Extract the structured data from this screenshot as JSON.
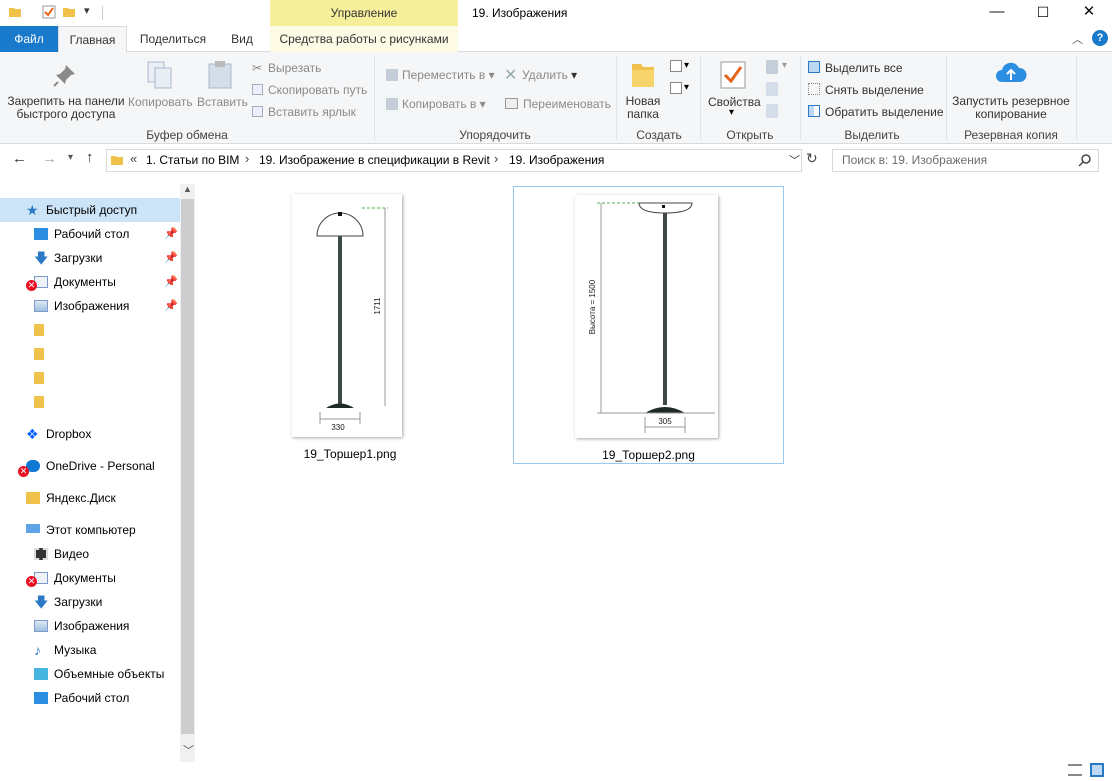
{
  "window": {
    "title": "19. Изображения",
    "context_tab_header": "Управление",
    "controls": {
      "minimize": "—",
      "maximize": "☐",
      "close": "✕"
    }
  },
  "tabs": {
    "file": "Файл",
    "home": "Главная",
    "share": "Поделиться",
    "view": "Вид",
    "picture_tools": "Средства работы с рисунками"
  },
  "ribbon": {
    "clipboard": {
      "pin": "Закрепить на панели быстрого доступа",
      "pin_line1": "Закрепить на панели",
      "pin_line2": "быстрого доступа",
      "copy": "Копировать",
      "paste": "Вставить",
      "cut": "Вырезать",
      "copy_path": "Скопировать путь",
      "paste_shortcut": "Вставить ярлык",
      "group": "Буфер обмена"
    },
    "organize": {
      "move_to": "Переместить в",
      "copy_to": "Копировать в",
      "delete": "Удалить",
      "rename": "Переименовать",
      "group": "Упорядочить"
    },
    "new": {
      "new_folder_line1": "Новая",
      "new_folder_line2": "папка",
      "group": "Создать"
    },
    "open": {
      "properties": "Свойства",
      "group": "Открыть"
    },
    "select": {
      "select_all": "Выделить все",
      "select_none": "Снять выделение",
      "invert": "Обратить выделение",
      "group": "Выделить"
    },
    "backup": {
      "start_line1": "Запустить резервное",
      "start_line2": "копирование",
      "group": "Резервная копия"
    }
  },
  "address": {
    "overflow": "«",
    "crumbs": [
      "1. Статьи по BIM",
      "19. Изображение в спецификации в Revit",
      "19. Изображения"
    ],
    "search_placeholder": "Поиск в: 19. Изображения"
  },
  "nav_pane": {
    "quick_access": "Быстрый доступ",
    "quick_items": [
      "Рабочий стол",
      "Загрузки",
      "Документы",
      "Изображения"
    ],
    "dropbox": "Dropbox",
    "onedrive": "OneDrive - Personal",
    "yandex": "Яндекс.Диск",
    "this_pc": "Этот компьютер",
    "pc_items": [
      "Видео",
      "Документы",
      "Загрузки",
      "Изображения",
      "Музыка",
      "Объемные объекты",
      "Рабочий стол"
    ]
  },
  "files": [
    {
      "name": "19_Торшер1.png",
      "dim_height": "1711",
      "dim_width": "330"
    },
    {
      "name": "19_Торшер2.png",
      "dim_height": "Высота = 1500",
      "dim_width": "305"
    }
  ],
  "colors": {
    "accent": "#1979ca",
    "context_tab": "#f5ef9b",
    "selection": "#cce4f7",
    "error_badge": "#e81123"
  }
}
